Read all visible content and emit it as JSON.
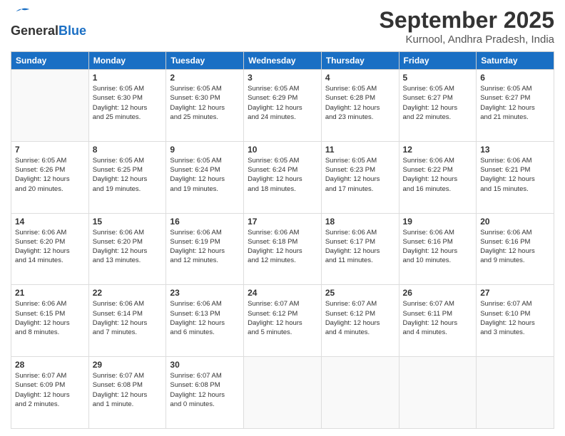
{
  "logo": {
    "line1": "General",
    "line2": "Blue"
  },
  "title": "September 2025",
  "subtitle": "Kurnool, Andhra Pradesh, India",
  "weekdays": [
    "Sunday",
    "Monday",
    "Tuesday",
    "Wednesday",
    "Thursday",
    "Friday",
    "Saturday"
  ],
  "weeks": [
    [
      {
        "day": "",
        "info": ""
      },
      {
        "day": "1",
        "info": "Sunrise: 6:05 AM\nSunset: 6:30 PM\nDaylight: 12 hours\nand 25 minutes."
      },
      {
        "day": "2",
        "info": "Sunrise: 6:05 AM\nSunset: 6:30 PM\nDaylight: 12 hours\nand 25 minutes."
      },
      {
        "day": "3",
        "info": "Sunrise: 6:05 AM\nSunset: 6:29 PM\nDaylight: 12 hours\nand 24 minutes."
      },
      {
        "day": "4",
        "info": "Sunrise: 6:05 AM\nSunset: 6:28 PM\nDaylight: 12 hours\nand 23 minutes."
      },
      {
        "day": "5",
        "info": "Sunrise: 6:05 AM\nSunset: 6:27 PM\nDaylight: 12 hours\nand 22 minutes."
      },
      {
        "day": "6",
        "info": "Sunrise: 6:05 AM\nSunset: 6:27 PM\nDaylight: 12 hours\nand 21 minutes."
      }
    ],
    [
      {
        "day": "7",
        "info": "Sunrise: 6:05 AM\nSunset: 6:26 PM\nDaylight: 12 hours\nand 20 minutes."
      },
      {
        "day": "8",
        "info": "Sunrise: 6:05 AM\nSunset: 6:25 PM\nDaylight: 12 hours\nand 19 minutes."
      },
      {
        "day": "9",
        "info": "Sunrise: 6:05 AM\nSunset: 6:24 PM\nDaylight: 12 hours\nand 19 minutes."
      },
      {
        "day": "10",
        "info": "Sunrise: 6:05 AM\nSunset: 6:24 PM\nDaylight: 12 hours\nand 18 minutes."
      },
      {
        "day": "11",
        "info": "Sunrise: 6:05 AM\nSunset: 6:23 PM\nDaylight: 12 hours\nand 17 minutes."
      },
      {
        "day": "12",
        "info": "Sunrise: 6:06 AM\nSunset: 6:22 PM\nDaylight: 12 hours\nand 16 minutes."
      },
      {
        "day": "13",
        "info": "Sunrise: 6:06 AM\nSunset: 6:21 PM\nDaylight: 12 hours\nand 15 minutes."
      }
    ],
    [
      {
        "day": "14",
        "info": "Sunrise: 6:06 AM\nSunset: 6:20 PM\nDaylight: 12 hours\nand 14 minutes."
      },
      {
        "day": "15",
        "info": "Sunrise: 6:06 AM\nSunset: 6:20 PM\nDaylight: 12 hours\nand 13 minutes."
      },
      {
        "day": "16",
        "info": "Sunrise: 6:06 AM\nSunset: 6:19 PM\nDaylight: 12 hours\nand 12 minutes."
      },
      {
        "day": "17",
        "info": "Sunrise: 6:06 AM\nSunset: 6:18 PM\nDaylight: 12 hours\nand 12 minutes."
      },
      {
        "day": "18",
        "info": "Sunrise: 6:06 AM\nSunset: 6:17 PM\nDaylight: 12 hours\nand 11 minutes."
      },
      {
        "day": "19",
        "info": "Sunrise: 6:06 AM\nSunset: 6:16 PM\nDaylight: 12 hours\nand 10 minutes."
      },
      {
        "day": "20",
        "info": "Sunrise: 6:06 AM\nSunset: 6:16 PM\nDaylight: 12 hours\nand 9 minutes."
      }
    ],
    [
      {
        "day": "21",
        "info": "Sunrise: 6:06 AM\nSunset: 6:15 PM\nDaylight: 12 hours\nand 8 minutes."
      },
      {
        "day": "22",
        "info": "Sunrise: 6:06 AM\nSunset: 6:14 PM\nDaylight: 12 hours\nand 7 minutes."
      },
      {
        "day": "23",
        "info": "Sunrise: 6:06 AM\nSunset: 6:13 PM\nDaylight: 12 hours\nand 6 minutes."
      },
      {
        "day": "24",
        "info": "Sunrise: 6:07 AM\nSunset: 6:12 PM\nDaylight: 12 hours\nand 5 minutes."
      },
      {
        "day": "25",
        "info": "Sunrise: 6:07 AM\nSunset: 6:12 PM\nDaylight: 12 hours\nand 4 minutes."
      },
      {
        "day": "26",
        "info": "Sunrise: 6:07 AM\nSunset: 6:11 PM\nDaylight: 12 hours\nand 4 minutes."
      },
      {
        "day": "27",
        "info": "Sunrise: 6:07 AM\nSunset: 6:10 PM\nDaylight: 12 hours\nand 3 minutes."
      }
    ],
    [
      {
        "day": "28",
        "info": "Sunrise: 6:07 AM\nSunset: 6:09 PM\nDaylight: 12 hours\nand 2 minutes."
      },
      {
        "day": "29",
        "info": "Sunrise: 6:07 AM\nSunset: 6:08 PM\nDaylight: 12 hours\nand 1 minute."
      },
      {
        "day": "30",
        "info": "Sunrise: 6:07 AM\nSunset: 6:08 PM\nDaylight: 12 hours\nand 0 minutes."
      },
      {
        "day": "",
        "info": ""
      },
      {
        "day": "",
        "info": ""
      },
      {
        "day": "",
        "info": ""
      },
      {
        "day": "",
        "info": ""
      }
    ]
  ]
}
